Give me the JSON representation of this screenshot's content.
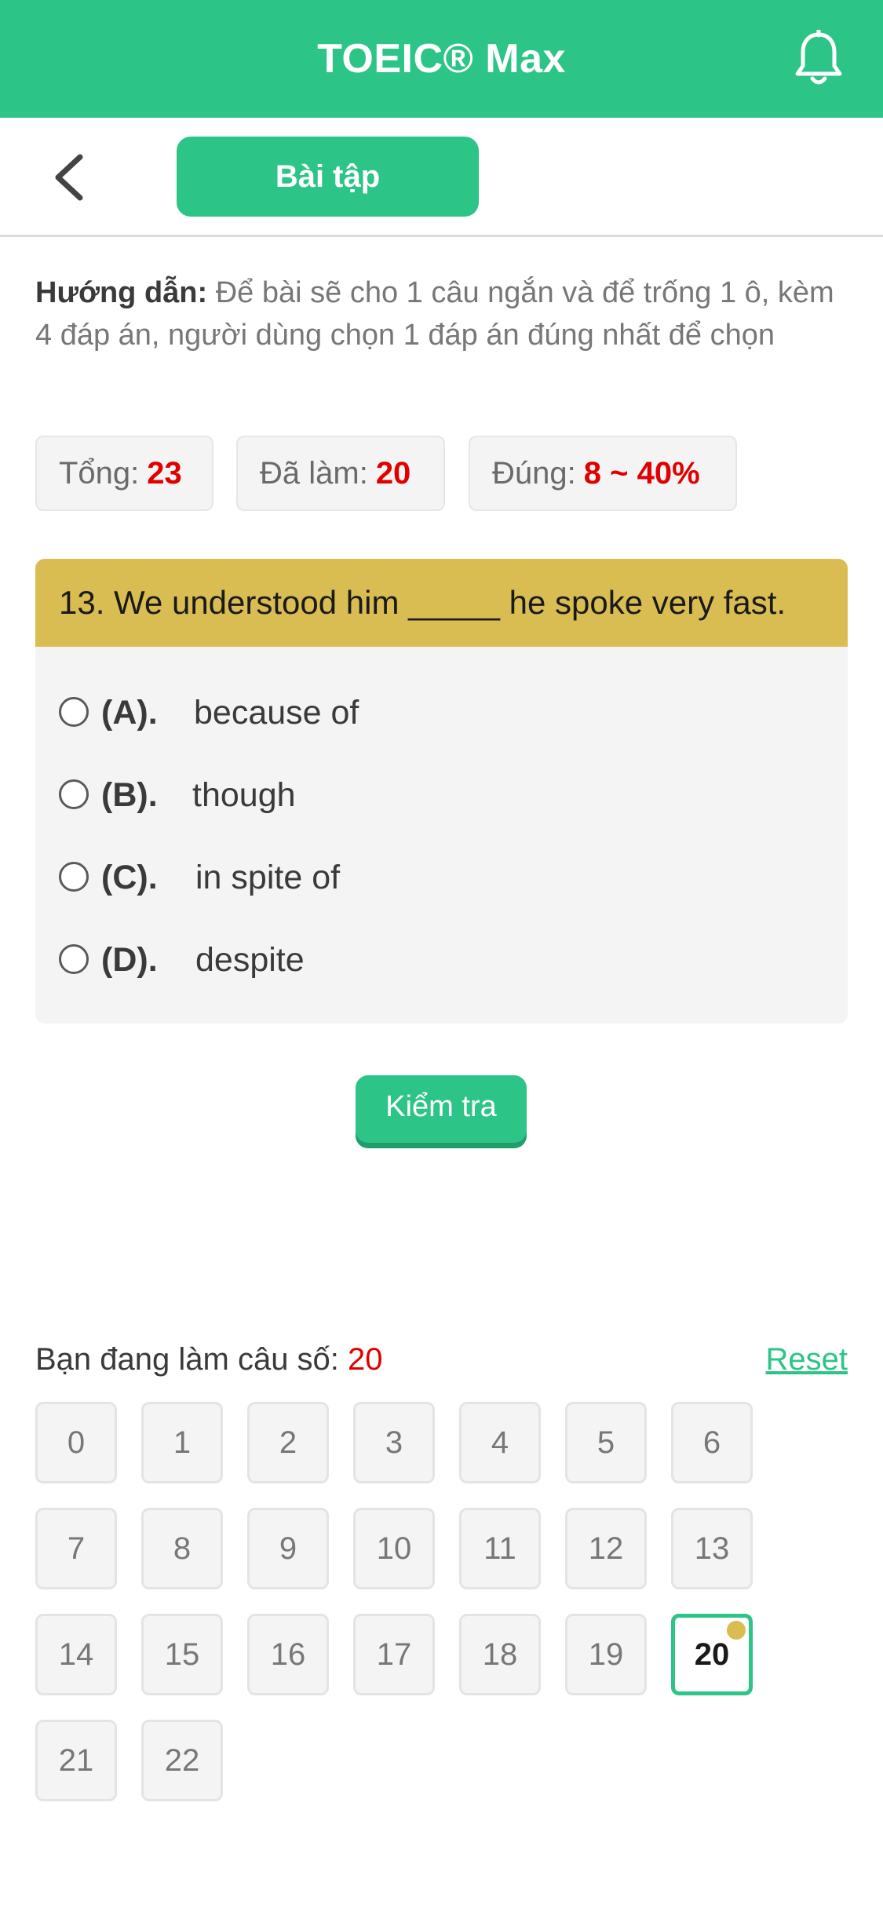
{
  "header": {
    "title": "TOEIC® Max",
    "notification_icon": "bell-icon",
    "color": "#2dc487"
  },
  "subnav": {
    "back_icon": "chevron-left-icon",
    "tab_label": "Bài tập"
  },
  "instructions": {
    "label": "Hướng dẫn:",
    "text": "Để bài sẽ cho 1 câu ngắn và để trống 1 ô, kèm 4 đáp án, người dùng chọn 1 đáp án đúng nhất để chọn"
  },
  "stats": {
    "total_label": "Tổng:",
    "total_value": "23",
    "done_label": "Đã làm:",
    "done_value": "20",
    "correct_label": "Đúng:",
    "correct_value": "8 ~ 40%"
  },
  "question": {
    "text": "13. We understood him _____ he spoke very fast.",
    "options": [
      {
        "letter": "(A).",
        "text": "because of"
      },
      {
        "letter": "(B).",
        "text": "though"
      },
      {
        "letter": "(C).",
        "text": "in spite of"
      },
      {
        "letter": "(D).",
        "text": "despite"
      }
    ]
  },
  "check_button": "Kiểm tra",
  "navigator": {
    "current_label": "Bạn đang làm câu số:",
    "current_value": "20",
    "reset_label": "Reset",
    "numbers": [
      "0",
      "1",
      "2",
      "3",
      "4",
      "5",
      "6",
      "7",
      "8",
      "9",
      "10",
      "11",
      "12",
      "13",
      "14",
      "15",
      "16",
      "17",
      "18",
      "19",
      "20",
      "21",
      "22"
    ],
    "active_number": "20"
  }
}
